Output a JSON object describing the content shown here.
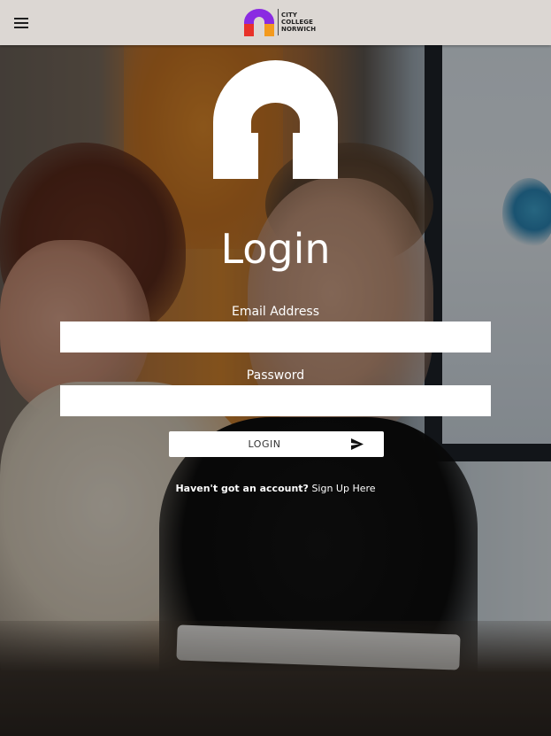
{
  "header": {
    "menu_icon": "hamburger-menu-icon",
    "brand": {
      "logo_icon": "city-college-norwich-arch-icon",
      "line1": "CITY",
      "line2": "COLLEGE",
      "line3": "NORWICH",
      "colors": {
        "arch": "#8a2be2",
        "left_block": "#e8322a",
        "right_block": "#f39a1e"
      }
    }
  },
  "hero": {
    "logo_icon": "college-arch-logo-icon",
    "title": "Login"
  },
  "form": {
    "email_label": "Email Address",
    "email_value": "",
    "password_label": "Password",
    "password_value": "",
    "login_button_label": "LOGIN",
    "login_button_icon": "send-arrow-icon"
  },
  "signup": {
    "prompt": "Haven't got an account?",
    "link_label": "Sign Up Here"
  },
  "colors": {
    "header_bg": "#dcd7d3",
    "text_on_hero": "#ffffff",
    "input_bg": "#ffffff"
  }
}
